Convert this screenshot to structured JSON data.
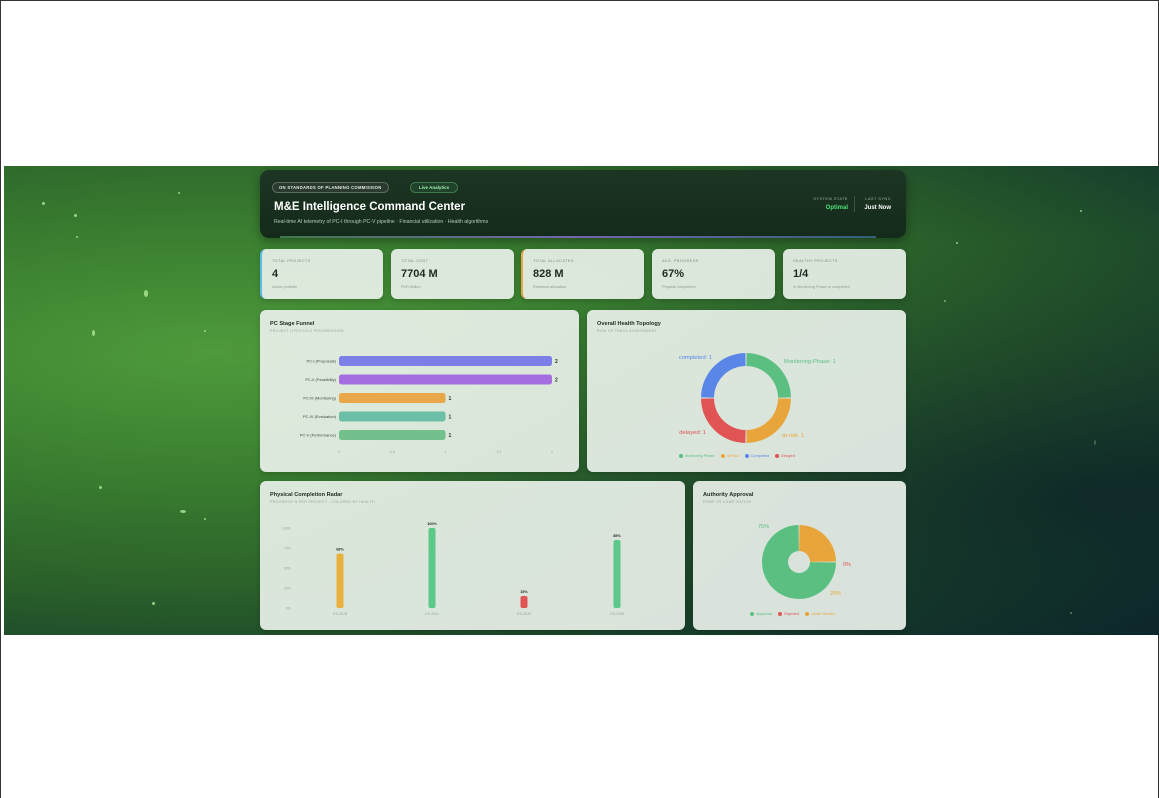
{
  "header": {
    "badge_standard": "ON STANDARDS OF PLANNING COMMISSION",
    "badge_live": "Live Analytics",
    "title": "M&E Intelligence Command Center",
    "subtitle": "Real-time AI telemetry of PC-I through PC-V pipeline · Financial utilization · Health algorithms",
    "system_state_label": "SYSTEM STATE",
    "system_state_value": "Optimal",
    "last_sync_label": "LAST SYNC",
    "last_sync_value": "Just Now",
    "colors": {
      "optimal": "#4ee07a",
      "accent_green": "#9ff0b0"
    }
  },
  "kpis": [
    {
      "label": "TOTAL PROJECTS",
      "value": "4",
      "sub": "Active portfolio",
      "accent": "#5fb9e6"
    },
    {
      "label": "TOTAL COST",
      "value": "7704 M",
      "sub": "PKR Million",
      "accent": ""
    },
    {
      "label": "TOTAL ALLOCATED",
      "value": "828 M",
      "sub": "Released allocation",
      "accent": "#e8a84a"
    },
    {
      "label": "AVG. PROGRESS",
      "value": "67%",
      "sub": "Physical completion",
      "accent": ""
    },
    {
      "label": "HEALTHY PROJECTS",
      "value": "1/4",
      "sub": "In Monitoring Phase or completed",
      "accent": ""
    }
  ],
  "funnel": {
    "title": "PC Stage Funnel",
    "subtitle": "PROJECT LIFECYCLE PROGRESSION"
  },
  "health": {
    "title": "Overall Health Topology",
    "subtitle": "RISK VS TRACK ASSESSMENT",
    "legend": [
      {
        "label": "Monitoring Phase",
        "color": "#5cbf82"
      },
      {
        "label": "At Risk",
        "color": "#e8a53c"
      },
      {
        "label": "Completed",
        "color": "#5a86e8"
      },
      {
        "label": "Delayed",
        "color": "#e05454"
      }
    ]
  },
  "radar": {
    "title": "Physical Completion Radar",
    "subtitle": "PROGRESS % PER PROJECT - COLORED BY HEALTH"
  },
  "approval": {
    "title": "Authority Approval",
    "subtitle": "PDWP VS CDWP RATIOS",
    "legend": [
      {
        "label": "Approved",
        "color": "#5cbf82"
      },
      {
        "label": "Rejected",
        "color": "#e05454"
      },
      {
        "label": "Under Review",
        "color": "#e8a53c"
      }
    ]
  },
  "chart_data": [
    {
      "type": "bar",
      "orientation": "horizontal",
      "categories": [
        "PC-I (Proposals)",
        "PC-II (Feasibility)",
        "PC-III (Monitoring)",
        "PC-IV (Evaluation)",
        "PC-V (Performance)"
      ],
      "values": [
        2,
        2,
        1,
        1,
        1
      ],
      "colors": [
        "#7b7fe6",
        "#a46ee0",
        "#e8a84a",
        "#6cbfa6",
        "#72c08c"
      ],
      "xticks": [
        "0",
        "0.5",
        "1",
        "1.5",
        "2"
      ],
      "xlim": [
        0,
        2
      ],
      "data_labels": true
    },
    {
      "type": "pie",
      "donut": true,
      "slices": [
        {
          "name": "Monitoring Phase",
          "label": "Monitoring-Phase: 1",
          "value": 1,
          "color": "#5cbf82"
        },
        {
          "name": "At Risk",
          "label": "at-risk: 1",
          "value": 1,
          "color": "#e8a53c"
        },
        {
          "name": "Delayed",
          "label": "delayed: 1",
          "value": 1,
          "color": "#e05454"
        },
        {
          "name": "Completed",
          "label": "completed: 1",
          "value": 1,
          "color": "#5a86e8"
        }
      ]
    },
    {
      "type": "bar",
      "categories": [
        "GS-2078",
        "GS-2031",
        "GS-2034",
        "GS-2395"
      ],
      "values": [
        68,
        100,
        15,
        85
      ],
      "value_labels": [
        "68%",
        "100%",
        "15%",
        "85%"
      ],
      "colors": [
        "#e8b03c",
        "#5cc88a",
        "#e05454",
        "#5cc88a"
      ],
      "yticks": [
        "100%",
        "75%",
        "50%",
        "25%",
        "0%"
      ],
      "ylim": [
        0,
        100
      ]
    },
    {
      "type": "pie",
      "donut": true,
      "slices": [
        {
          "name": "Approved",
          "label": "75%",
          "value": 75,
          "color": "#5cbf82"
        },
        {
          "name": "Rejected",
          "label": "0%",
          "value": 0,
          "color": "#e05454"
        },
        {
          "name": "Under Review",
          "label": "25%",
          "value": 25,
          "color": "#e8a53c"
        }
      ]
    }
  ]
}
